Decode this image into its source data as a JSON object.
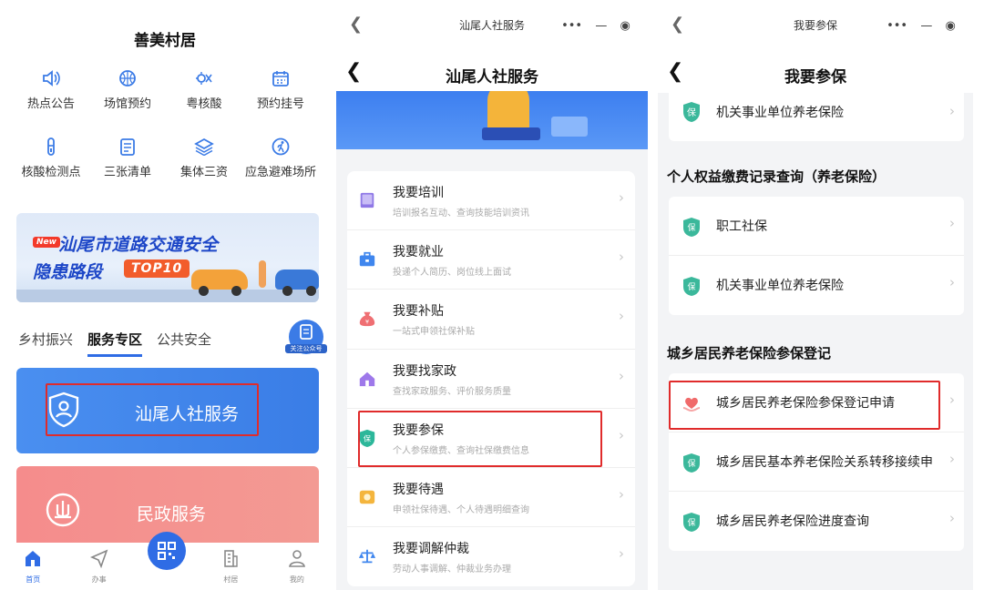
{
  "panel1": {
    "title": "善美村居",
    "grid_row1": [
      {
        "label": "热点公告",
        "icon": "speaker-icon"
      },
      {
        "label": "场馆预约",
        "icon": "basketball-icon"
      },
      {
        "label": "粤核酸",
        "icon": "virus-icon"
      },
      {
        "label": "预约挂号",
        "icon": "calendar-icon"
      }
    ],
    "grid_row2": [
      {
        "label": "核酸检测点",
        "icon": "test-tube-icon"
      },
      {
        "label": "三张清单",
        "icon": "checklist-icon"
      },
      {
        "label": "集体三资",
        "icon": "layers-icon"
      },
      {
        "label": "应急避难场所",
        "icon": "run-icon"
      }
    ],
    "banner": {
      "badge": "New",
      "line1": "汕尾市道路交通安全",
      "line2": "隐患路段",
      "tag": "TOP10"
    },
    "tabs": [
      "乡村振兴",
      "服务专区",
      "公共安全"
    ],
    "active_tab": "服务专区",
    "follow_label": "关注公众号",
    "service_card1": "汕尾人社服务",
    "service_card2": "民政服务",
    "bottom_nav": [
      "首页",
      "办事",
      "村居",
      "我的"
    ],
    "colors": {
      "accent": "#2f6ce5",
      "card_blue": "#4a8ff0",
      "card_red": "#f58c8c",
      "highlight": "#e02b2b"
    }
  },
  "panel2": {
    "mini_title": "汕尾人社服务",
    "nav_title": "汕尾人社服务",
    "items": [
      {
        "title": "我要培训",
        "sub": "培训报名互动、查询技能培训资讯",
        "icon": "book-icon",
        "color": "#8f78e6"
      },
      {
        "title": "我要就业",
        "sub": "投递个人简历、岗位线上面试",
        "icon": "briefcase-icon",
        "color": "#3f86ee"
      },
      {
        "title": "我要补贴",
        "sub": "一站式申领社保补贴",
        "icon": "money-bag-icon",
        "color": "#ef6f73"
      },
      {
        "title": "我要找家政",
        "sub": "查找家政服务、评价服务质量",
        "icon": "house-icon",
        "color": "#9e78ea"
      },
      {
        "title": "我要参保",
        "sub": "个人参保缴费、查询社保缴费信息",
        "icon": "shield-icon",
        "color": "#2cb79a"
      },
      {
        "title": "我要待遇",
        "sub": "申领社保待遇、个人待遇明细查询",
        "icon": "coin-icon",
        "color": "#f4b53d"
      },
      {
        "title": "我要调解仲裁",
        "sub": "劳动人事调解、仲裁业务办理",
        "icon": "scale-icon",
        "color": "#3f86ee"
      }
    ]
  },
  "panel3": {
    "mini_title": "我要参保",
    "nav_title": "我要参保",
    "top_item": "机关事业单位养老保险",
    "section1": "个人权益缴费记录查询（养老保险）",
    "section1_items": [
      "职工社保",
      "机关事业单位养老保险"
    ],
    "section2": "城乡居民养老保险参保登记",
    "section2_items": [
      {
        "title": "城乡居民养老保险参保登记申请",
        "icon": "heart-hand-icon"
      },
      {
        "title": "城乡居民基本养老保险关系转移接续申",
        "icon": "shield-icon"
      },
      {
        "title": "城乡居民养老保险进度查询",
        "icon": "shield-icon"
      }
    ],
    "shield_badge": "保",
    "colors": {
      "shield": "#3bb89b"
    }
  }
}
